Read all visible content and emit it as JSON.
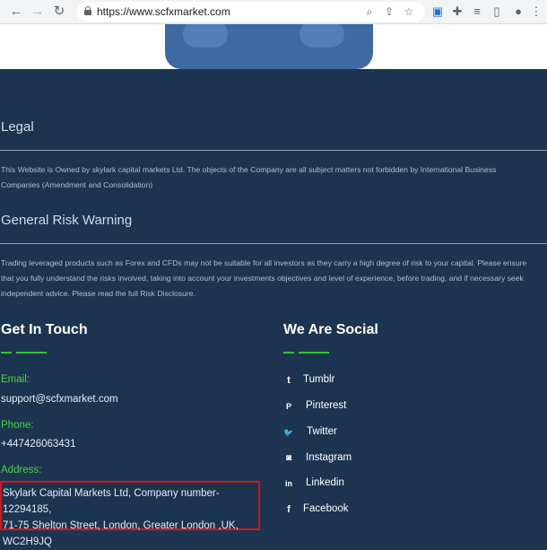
{
  "browser": {
    "url": "https://www.scfxmarket.com"
  },
  "legal": {
    "heading": "Legal",
    "lines": [
      "This Website is Owned by skylark capital markets Ltd. The objects of the Company are all subject matters not forbidden by International Business",
      "Companies (Amendment and Consolidation)"
    ]
  },
  "risk": {
    "heading": "General Risk Warning",
    "lines": [
      "Trading leveraged products such as Forex and CFDs may not be suitable for all investors as they carry a high degree of risk to your capital. Please ensure",
      "that you fully understand the risks involved, taking into account your investments objectives and level of experience, before trading, and if necessary seek",
      "independent advice. Please read the full Risk Disclosure."
    ]
  },
  "contact": {
    "title": "Get In Touch",
    "email_label": "Email:",
    "email": "support@scfxmarket.com",
    "phone_label": "Phone:",
    "phone": "+447426063431",
    "address_label": "Address:",
    "address_lines": [
      "Skylark Capital Markets Ltd, Company number- 12294185,",
      "71-75 Shelton Street, London, Greater London ,UK,",
      "WC2H9JQ"
    ]
  },
  "social": {
    "title": "We Are Social",
    "items": [
      {
        "label": "Tumblr",
        "icon": "t"
      },
      {
        "label": "Pinterest",
        "icon": "P"
      },
      {
        "label": "Twitter",
        "icon": "🐦"
      },
      {
        "label": "Instagram",
        "icon": "◙"
      },
      {
        "label": "Linkedin",
        "icon": "in"
      },
      {
        "label": "Facebook",
        "icon": "f"
      }
    ]
  },
  "colors": {
    "background": "#1d3450",
    "accent": "#31c434",
    "highlight_border": "#d01818"
  }
}
